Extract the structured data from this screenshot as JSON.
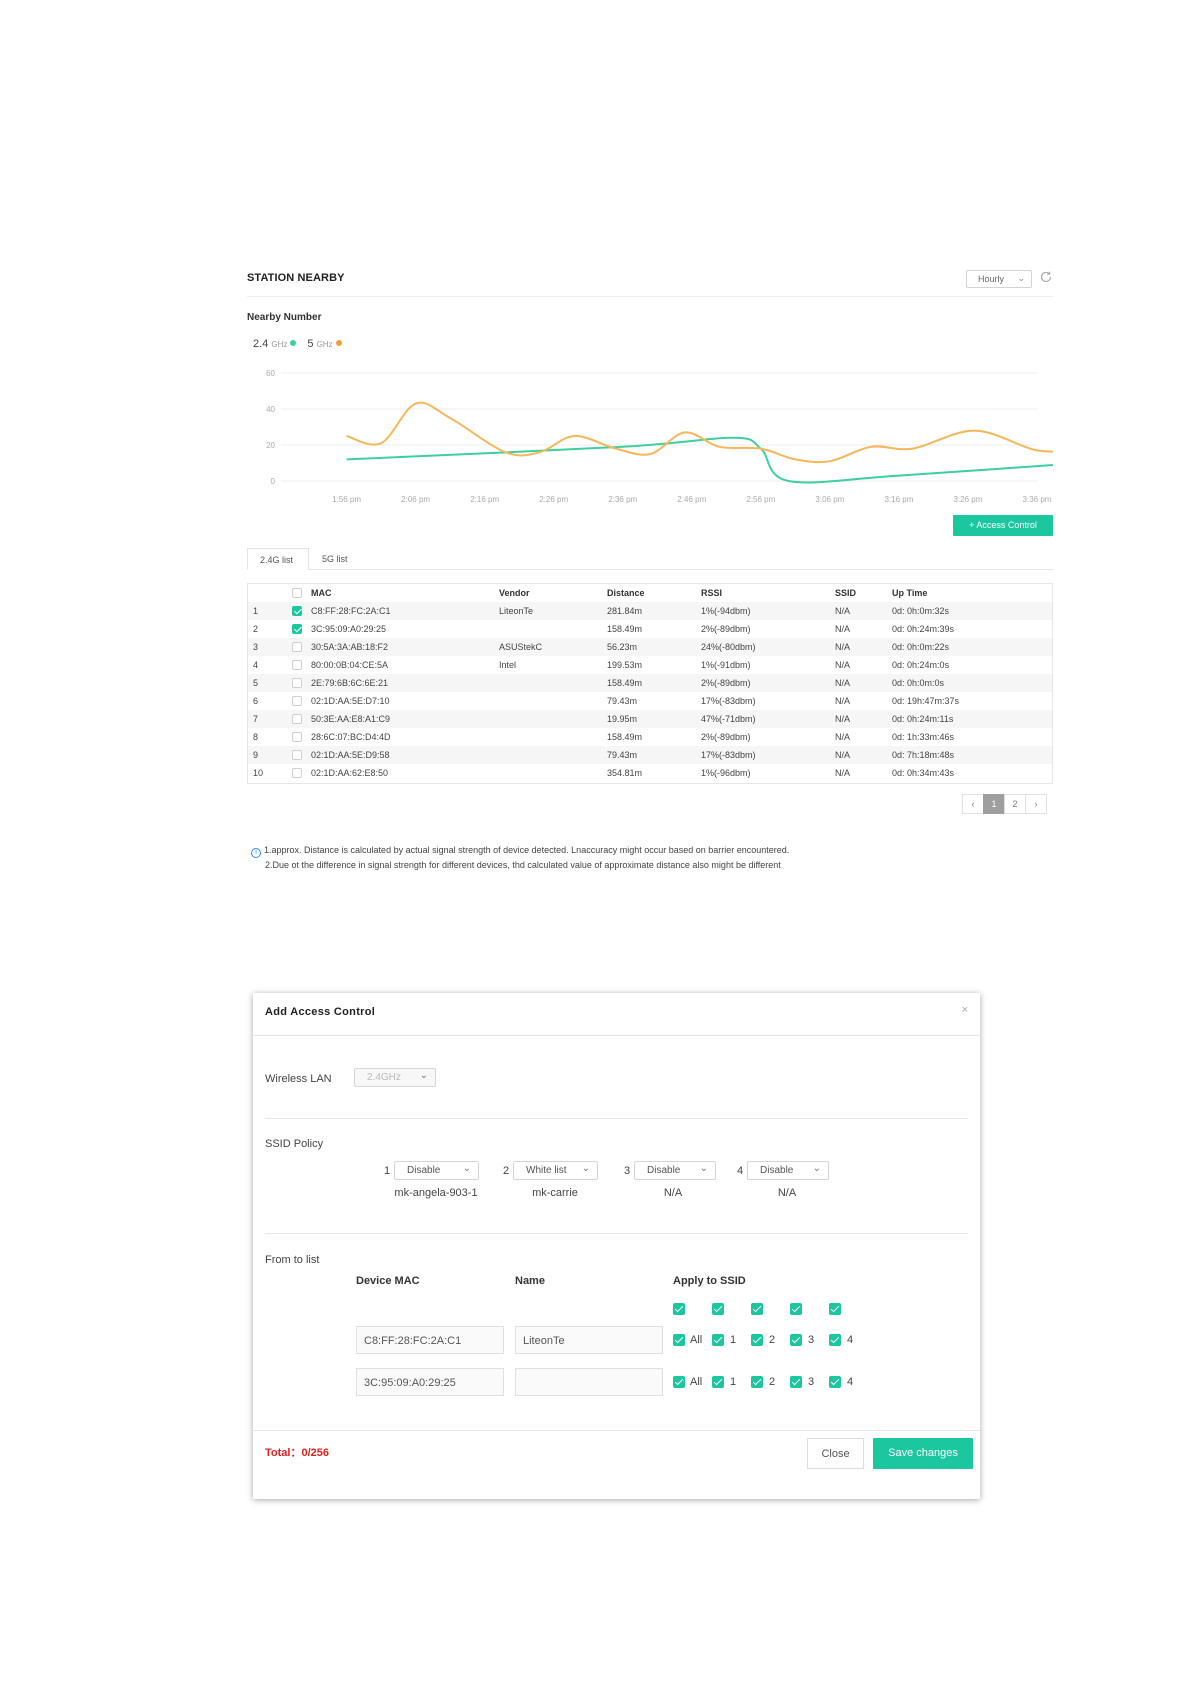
{
  "station": {
    "title": "STATION NEARBY",
    "interval": "Hourly",
    "nearby_label": "Nearby Number",
    "legend": [
      {
        "name": "2.4",
        "unit": "GHz",
        "color": "#3ecf9f"
      },
      {
        "name": "5",
        "unit": "GHz",
        "color": "#f39c3c"
      }
    ],
    "access_control_btn": "+ Access Control",
    "tabs": [
      "2.4G list",
      "5G list"
    ],
    "columns": [
      "MAC",
      "Vendor",
      "Distance",
      "RSSI",
      "SSID",
      "Up Time"
    ],
    "rows": [
      {
        "no": "1",
        "checked": true,
        "mac": "C8:FF:28:FC:2A:C1",
        "vendor": "LiteonTe",
        "distance": "281.84m",
        "rssi": "1%(-94dbm)",
        "ssid": "N/A",
        "uptime": "0d: 0h:0m:32s"
      },
      {
        "no": "2",
        "checked": true,
        "mac": "3C:95:09:A0:29:25",
        "vendor": "",
        "distance": "158.49m",
        "rssi": "2%(-89dbm)",
        "ssid": "N/A",
        "uptime": "0d: 0h:24m:39s"
      },
      {
        "no": "3",
        "checked": false,
        "mac": "30:5A:3A:AB:18:F2",
        "vendor": "ASUStekC",
        "distance": "56.23m",
        "rssi": "24%(-80dbm)",
        "ssid": "N/A",
        "uptime": "0d: 0h:0m:22s"
      },
      {
        "no": "4",
        "checked": false,
        "mac": "80:00:0B:04:CE:5A",
        "vendor": "Intel",
        "distance": "199.53m",
        "rssi": "1%(-91dbm)",
        "ssid": "N/A",
        "uptime": "0d: 0h:24m:0s"
      },
      {
        "no": "5",
        "checked": false,
        "mac": "2E:79:6B:6C:6E:21",
        "vendor": "",
        "distance": "158.49m",
        "rssi": "2%(-89dbm)",
        "ssid": "N/A",
        "uptime": "0d: 0h:0m:0s"
      },
      {
        "no": "6",
        "checked": false,
        "mac": "02:1D:AA:5E:D7:10",
        "vendor": "",
        "distance": "79.43m",
        "rssi": "17%(-83dbm)",
        "ssid": "N/A",
        "uptime": "0d: 19h:47m:37s"
      },
      {
        "no": "7",
        "checked": false,
        "mac": "50:3E:AA:E8:A1:C9",
        "vendor": "",
        "distance": "19.95m",
        "rssi": "47%(-71dbm)",
        "ssid": "N/A",
        "uptime": "0d: 0h:24m:11s"
      },
      {
        "no": "8",
        "checked": false,
        "mac": "28:6C:07:BC:D4:4D",
        "vendor": "",
        "distance": "158.49m",
        "rssi": "2%(-89dbm)",
        "ssid": "N/A",
        "uptime": "0d: 1h:33m:46s"
      },
      {
        "no": "9",
        "checked": false,
        "mac": "02:1D:AA:5E:D9:58",
        "vendor": "",
        "distance": "79.43m",
        "rssi": "17%(-83dbm)",
        "ssid": "N/A",
        "uptime": "0d: 7h:18m:48s"
      },
      {
        "no": "10",
        "checked": false,
        "mac": "02:1D:AA:62:E8:50",
        "vendor": "",
        "distance": "354.81m",
        "rssi": "1%(-96dbm)",
        "ssid": "N/A",
        "uptime": "0d: 0h:34m:43s"
      }
    ],
    "pager": {
      "prev": "‹",
      "pages": [
        "1",
        "2"
      ],
      "current": "1",
      "next": "›"
    },
    "notes": [
      "1.approx. Distance is calculated by actual signal strength of device detected. Lnaccuracy might occur based on barrier encountered.",
      "2.Due ot the difference in signal strength for different devices, thd calculated value of approximate distance also might be different"
    ]
  },
  "chart_data": {
    "type": "line",
    "x": [
      "1:56 pm",
      "2:06 pm",
      "2:16 pm",
      "2:26 pm",
      "2:36 pm",
      "2:46 pm",
      "2:56 pm",
      "3:06 pm",
      "3:16 pm",
      "3:26 pm",
      "3:36 pm"
    ],
    "ylim": [
      0,
      60
    ],
    "yticks": [
      0,
      20,
      40,
      60
    ],
    "grid": true,
    "series": [
      {
        "name": "2.4GHz",
        "color": "#3ecf9f",
        "points": [
          [
            0.0,
            12
          ],
          [
            4.0,
            19
          ],
          [
            5.6,
            24
          ],
          [
            6.0,
            18
          ],
          [
            6.4,
            0
          ],
          [
            8.0,
            3
          ],
          [
            11.0,
            11
          ]
        ]
      },
      {
        "name": "5GHz",
        "color": "#f5b75a",
        "points": [
          [
            0.0,
            25
          ],
          [
            0.5,
            21
          ],
          [
            1.0,
            43
          ],
          [
            1.5,
            35
          ],
          [
            2.3,
            16
          ],
          [
            2.8,
            16
          ],
          [
            3.3,
            25
          ],
          [
            3.9,
            18
          ],
          [
            4.4,
            15
          ],
          [
            4.9,
            27
          ],
          [
            5.4,
            19
          ],
          [
            6.0,
            18
          ],
          [
            6.5,
            12
          ],
          [
            7.0,
            11
          ],
          [
            7.6,
            19
          ],
          [
            8.2,
            18
          ],
          [
            9.1,
            28
          ],
          [
            10.0,
            17
          ],
          [
            10.6,
            18
          ],
          [
            11.0,
            22
          ]
        ]
      }
    ]
  },
  "modal": {
    "title": "Add Access Control",
    "close_icon": "×",
    "wireless_label": "Wireless LAN",
    "wireless_value": "2.4GHz",
    "ssid_policy_label": "SSID Policy",
    "ssids": [
      {
        "num": "1",
        "policy": "Disable",
        "name": "mk-angela-903-1"
      },
      {
        "num": "2",
        "policy": "White list",
        "name": "mk-carrie"
      },
      {
        "num": "3",
        "policy": "Disable",
        "name": "N/A"
      },
      {
        "num": "4",
        "policy": "Disable",
        "name": "N/A"
      }
    ],
    "from_label": "From to list",
    "col_mac": "Device MAC",
    "col_name": "Name",
    "col_apply": "Apply to SSID",
    "devices": [
      {
        "mac": "C8:FF:28:FC:2A:C1",
        "name": "LiteonTe"
      },
      {
        "mac": "3C:95:09:A0:29:25",
        "name": ""
      }
    ],
    "apply_labels": [
      "All",
      "1",
      "2",
      "3",
      "4"
    ],
    "total": "Total：0/256",
    "close_btn": "Close",
    "save_btn": "Save changes"
  }
}
